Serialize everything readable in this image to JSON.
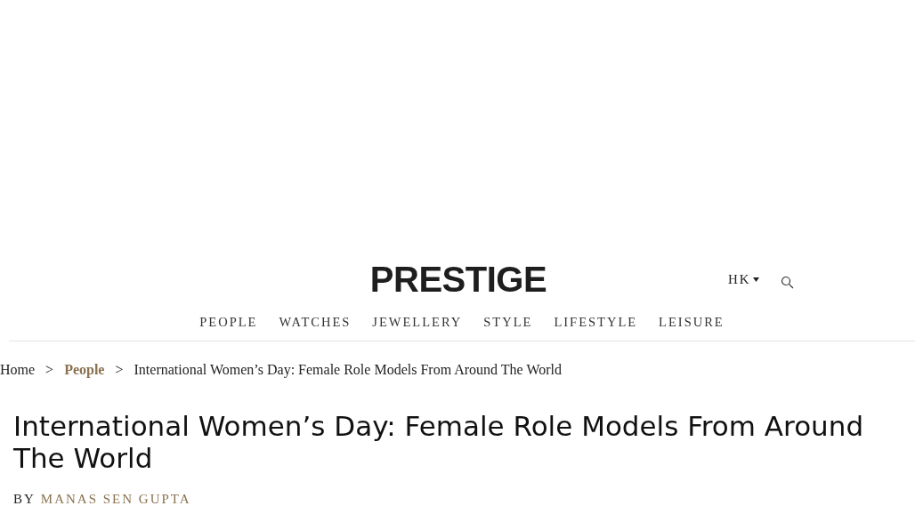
{
  "header": {
    "logo": "PRESTIGE",
    "region": "HK"
  },
  "nav": [
    {
      "label": "PEOPLE"
    },
    {
      "label": "WATCHES"
    },
    {
      "label": "JEWELLERY"
    },
    {
      "label": "STYLE"
    },
    {
      "label": "LIFESTYLE"
    },
    {
      "label": "LEISURE"
    }
  ],
  "breadcrumb": [
    {
      "label": "Home",
      "kind": "link"
    },
    {
      "label": "People",
      "kind": "section"
    },
    {
      "label": "International Women’s Day: Female Role Models From Around The World",
      "kind": "current"
    }
  ],
  "breadcrumb_separator": ">",
  "article": {
    "title": "International Women’s Day: Female Role Models From Around The World",
    "byline_prefix": "BY",
    "author": "MANAS SEN GUPTA"
  }
}
